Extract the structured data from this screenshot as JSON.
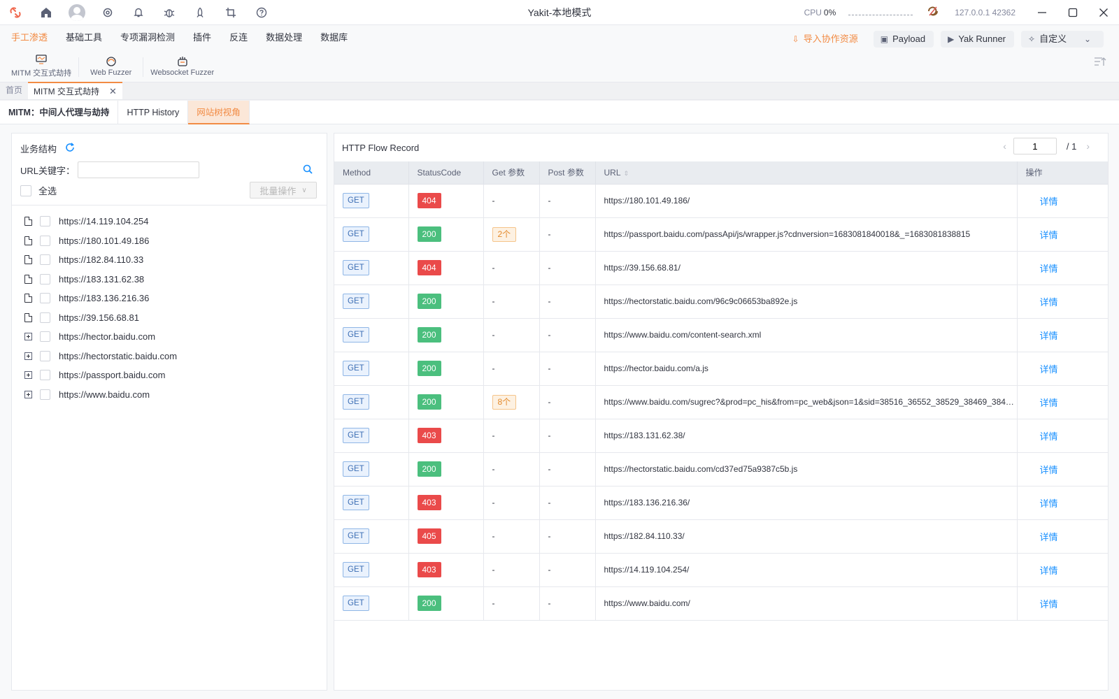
{
  "app": {
    "title": "Yakit-本地模式",
    "cpu_label": "CPU",
    "cpu_value": "0%",
    "host": "127.0.0.1 42362"
  },
  "menu": {
    "items": [
      {
        "label": "手工渗透",
        "active": true
      },
      {
        "label": "基础工具"
      },
      {
        "label": "专项漏洞检测"
      },
      {
        "label": "插件"
      },
      {
        "label": "反连"
      },
      {
        "label": "数据处理"
      },
      {
        "label": "数据库"
      }
    ],
    "sub_items": [
      {
        "label": "MITM 交互式劫持",
        "icon": "monitor-icon"
      },
      {
        "label": "Web Fuzzer",
        "icon": "fuzzer-icon"
      },
      {
        "label": "Websocket Fuzzer",
        "icon": "websocket-icon"
      }
    ],
    "import_label": "导入协作资源",
    "payload_label": "Payload",
    "yak_runner_label": "Yak Runner",
    "custom_label": "自定义"
  },
  "page_tabs": {
    "home": "首页",
    "active": "MITM 交互式劫持"
  },
  "sub_tabs": [
    {
      "label": "MITM：中间人代理与劫持"
    },
    {
      "label": "HTTP History"
    },
    {
      "label": "网站树视角",
      "active": true
    }
  ],
  "left_panel": {
    "title": "业务结构",
    "keyword_label": "URL关键字：",
    "keyword_value": "",
    "select_all": "全选",
    "batch_label": "批量操作",
    "tree": [
      {
        "url": "https://14.119.104.254",
        "type": "leaf"
      },
      {
        "url": "https://180.101.49.186",
        "type": "leaf"
      },
      {
        "url": "https://182.84.110.33",
        "type": "leaf"
      },
      {
        "url": "https://183.131.62.38",
        "type": "leaf"
      },
      {
        "url": "https://183.136.216.36",
        "type": "leaf"
      },
      {
        "url": "https://39.156.68.81",
        "type": "leaf"
      },
      {
        "url": "https://hector.baidu.com",
        "type": "folder"
      },
      {
        "url": "https://hectorstatic.baidu.com",
        "type": "folder"
      },
      {
        "url": "https://passport.baidu.com",
        "type": "folder"
      },
      {
        "url": "https://www.baidu.com",
        "type": "folder"
      }
    ]
  },
  "right_panel": {
    "title": "HTTP Flow Record",
    "page": "1",
    "total_pages": "/ 1",
    "columns": [
      "Method",
      "StatusCode",
      "Get 参数",
      "Post 参数",
      "URL",
      "操作"
    ],
    "rows": [
      {
        "method": "GET",
        "status": "404",
        "get": "-",
        "post": "-",
        "url": "https://180.101.49.186/",
        "action": "详情"
      },
      {
        "method": "GET",
        "status": "200",
        "get": "2个",
        "post": "-",
        "url": "https://passport.baidu.com/passApi/js/wrapper.js?cdnversion=1683081840018&_=1683081838815",
        "action": "详情"
      },
      {
        "method": "GET",
        "status": "404",
        "get": "-",
        "post": "-",
        "url": "https://39.156.68.81/",
        "action": "详情"
      },
      {
        "method": "GET",
        "status": "200",
        "get": "-",
        "post": "-",
        "url": "https://hectorstatic.baidu.com/96c9c06653ba892e.js",
        "action": "详情"
      },
      {
        "method": "GET",
        "status": "200",
        "get": "-",
        "post": "-",
        "url": "https://www.baidu.com/content-search.xml",
        "action": "详情"
      },
      {
        "method": "GET",
        "status": "200",
        "get": "-",
        "post": "-",
        "url": "https://hector.baidu.com/a.js",
        "action": "详情"
      },
      {
        "method": "GET",
        "status": "200",
        "get": "8个",
        "post": "-",
        "url": "https://www.baidu.com/sugrec?&prod=pc_his&from=pc_web&json=1&sid=38516_36552_38529_38469_3846...",
        "action": "详情"
      },
      {
        "method": "GET",
        "status": "403",
        "get": "-",
        "post": "-",
        "url": "https://183.131.62.38/",
        "action": "详情"
      },
      {
        "method": "GET",
        "status": "200",
        "get": "-",
        "post": "-",
        "url": "https://hectorstatic.baidu.com/cd37ed75a9387c5b.js",
        "action": "详情"
      },
      {
        "method": "GET",
        "status": "403",
        "get": "-",
        "post": "-",
        "url": "https://183.136.216.36/",
        "action": "详情"
      },
      {
        "method": "GET",
        "status": "405",
        "get": "-",
        "post": "-",
        "url": "https://182.84.110.33/",
        "action": "详情"
      },
      {
        "method": "GET",
        "status": "403",
        "get": "-",
        "post": "-",
        "url": "https://14.119.104.254/",
        "action": "详情"
      },
      {
        "method": "GET",
        "status": "200",
        "get": "-",
        "post": "-",
        "url": "https://www.baidu.com/",
        "action": "详情"
      }
    ]
  },
  "colors": {
    "accent": "#f28b44",
    "status_ok": "#4bbf7e",
    "status_err": "#ea4a4a",
    "link": "#1890ff"
  }
}
